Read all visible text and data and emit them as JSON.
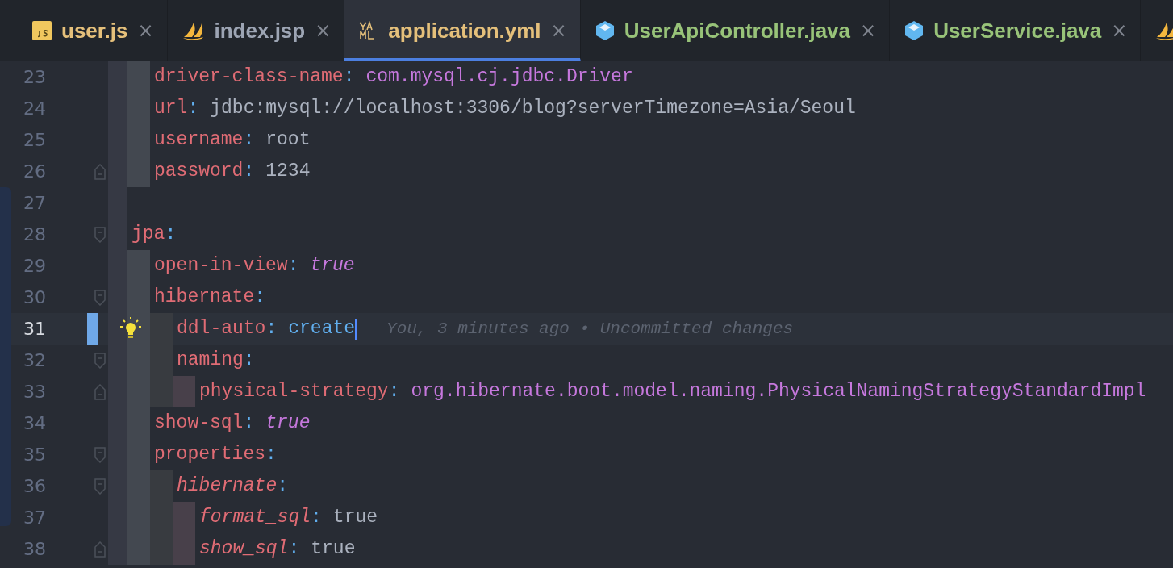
{
  "tabs": [
    {
      "label": "user.js",
      "kind": "js",
      "color": "#e5c07b",
      "selected": false
    },
    {
      "label": "index.jsp",
      "kind": "jsp",
      "color": "#9da5b4",
      "selected": false
    },
    {
      "label": "application.yml",
      "kind": "yaml",
      "color": "#e5c07b",
      "selected": true
    },
    {
      "label": "UserApiController.java",
      "kind": "java",
      "color": "#98c379",
      "selected": false
    },
    {
      "label": "UserService.java",
      "kind": "java",
      "color": "#98c379",
      "selected": false
    },
    {
      "kind": "jsp",
      "selected": false
    }
  ],
  "close_glyph": "×",
  "lines": [
    {
      "children": [
        {
          "number": "23",
          "key": "driver-class-name",
          "sep": ":",
          "value": {
            "text": "com.mysql.cj.jdbc.Driver",
            "kind": "string"
          }
        },
        {
          "number": "24",
          "key": "url",
          "sep": ":",
          "value": {
            "text": "jdbc:mysql://localhost:3306/blog?serverTimezone=Asia/Seoul",
            "kind": "plain"
          }
        },
        {
          "number": "25",
          "key": "username",
          "sep": ":",
          "value": {
            "text": "root",
            "kind": "plain"
          }
        },
        {
          "number": "26",
          "key": "password",
          "sep": ":",
          "value": {
            "text": "1234",
            "kind": "plain"
          },
          "fold": {
            "kind": "end"
          }
        }
      ]
    },
    {
      "number": "27"
    },
    {
      "number": "28",
      "key": "jpa",
      "sep": ":",
      "fold": {
        "kind": "start"
      },
      "children": [
        {
          "number": "29",
          "key": "open-in-view",
          "sep": ":",
          "value": {
            "text": "true",
            "kind": "bool"
          }
        },
        {
          "number": "30",
          "key": "hibernate",
          "sep": ":",
          "fold": {
            "kind": "start"
          },
          "children": [
            {
              "number": "31",
              "key": "ddl-auto",
              "sep": ":",
              "value": {
                "text": "create",
                "kind": "enum"
              },
              "current": true,
              "changed": true,
              "hint": true,
              "blame": "You, 3 minutes ago • Uncommitted changes"
            },
            {
              "number": "32",
              "key": "naming",
              "sep": ":",
              "fold": {
                "kind": "start"
              },
              "children": [
                {
                  "number": "33",
                  "key": "physical-strategy",
                  "sep": ":",
                  "value": {
                    "text": "org.hibernate.boot.model.naming.PhysicalNamingStrategyStandardImpl",
                    "kind": "string"
                  },
                  "fold": {
                    "kind": "end"
                  }
                }
              ]
            }
          ]
        },
        {
          "number": "34",
          "key": "show-sql",
          "sep": ":",
          "value": {
            "text": "true",
            "kind": "bool"
          }
        },
        {
          "number": "35",
          "key": "properties",
          "sep": ":",
          "fold": {
            "kind": "start"
          },
          "children": [
            {
              "number": "36",
              "key": "hibernate",
              "sep": ":",
              "key_italic": true,
              "fold": {
                "kind": "start"
              },
              "children": [
                {
                  "number": "37",
                  "key": "format_sql",
                  "sep": ":",
                  "key_italic": true,
                  "value": {
                    "text": "true",
                    "kind": "plain"
                  }
                },
                {
                  "number": "38",
                  "key": "show_sql",
                  "sep": ":",
                  "key_italic": true,
                  "value": {
                    "text": "true",
                    "kind": "plain"
                  },
                  "fold": {
                    "kind": "end"
                  }
                }
              ]
            }
          ]
        }
      ]
    }
  ]
}
